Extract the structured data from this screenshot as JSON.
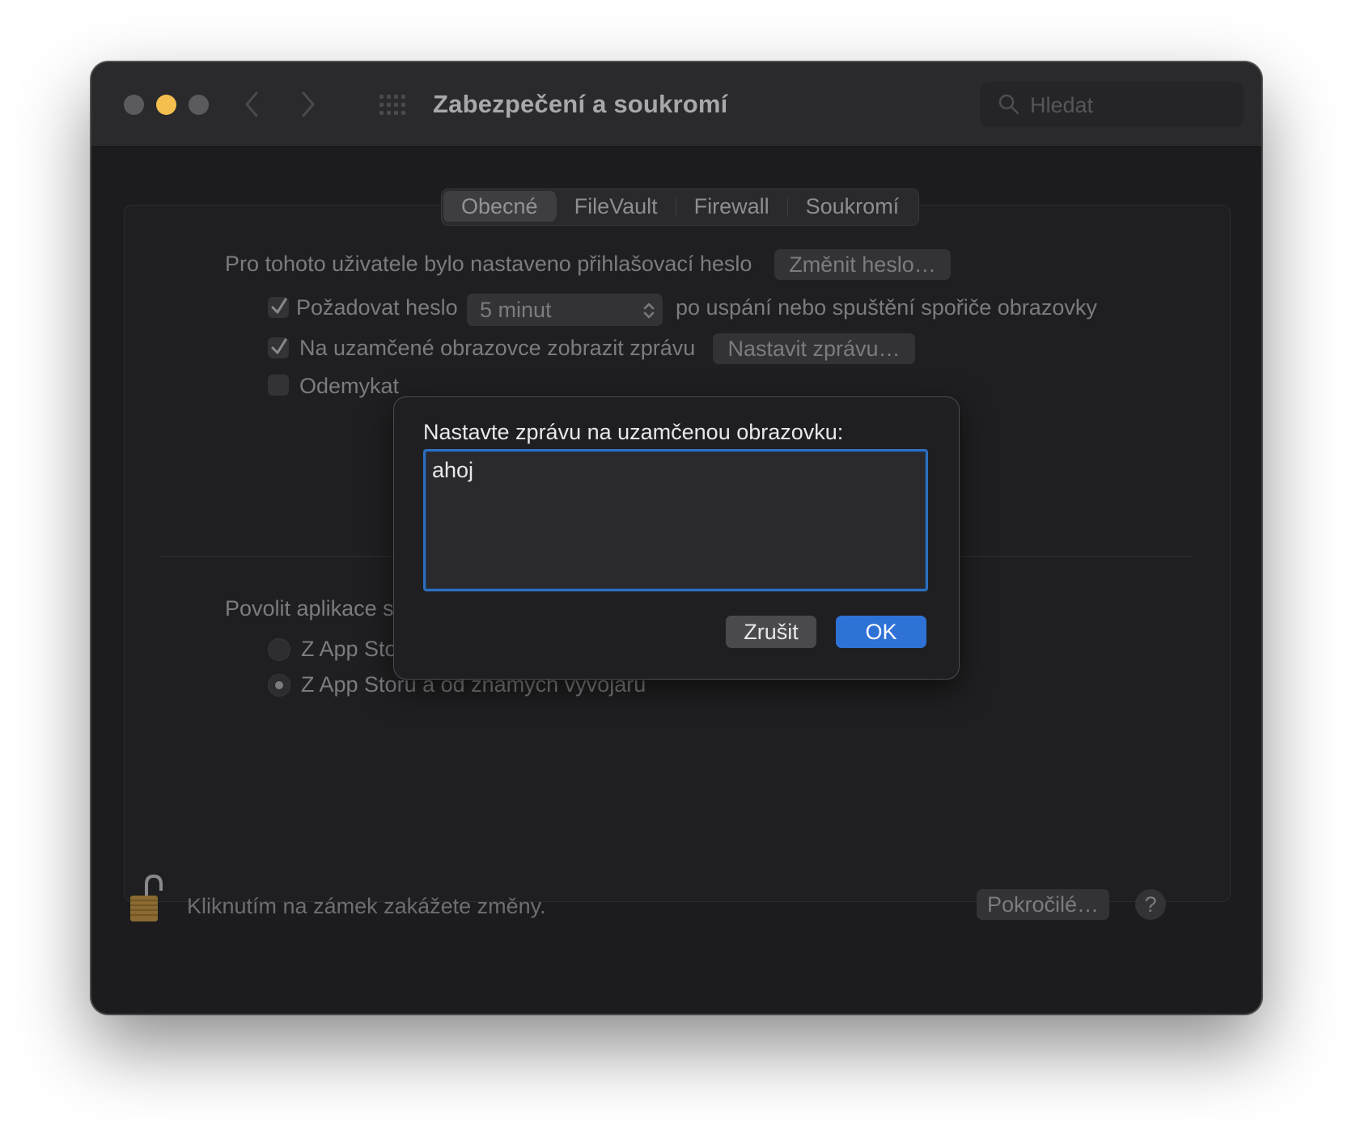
{
  "window": {
    "title": "Zabezpečení a soukromí",
    "search_placeholder": "Hledat"
  },
  "tabs": [
    {
      "label": "Obecné",
      "active": true
    },
    {
      "label": "FileVault",
      "active": false
    },
    {
      "label": "Firewall",
      "active": false
    },
    {
      "label": "Soukromí",
      "active": false
    }
  ],
  "general": {
    "password_text": "Pro tohoto uživatele bylo nastaveno přihlašovací heslo",
    "change_password_button": "Změnit heslo…",
    "require_password": {
      "label": "Požadovat heslo",
      "checked": true,
      "interval": "5 minut",
      "suffix": "po uspání nebo spuštění spořiče obrazovky"
    },
    "lock_message": {
      "label": "Na uzamčené obrazovce zobrazit zprávu",
      "checked": true,
      "button": "Nastavit zprávu…"
    },
    "unlock_partial": {
      "label": "Odemykat",
      "checked": false
    },
    "allow_apps_label": "Povolit aplikace s",
    "radio_app_store": {
      "label": "Z App Sto",
      "selected": false
    },
    "radio_app_store_devs": {
      "label": "Z App Storu a od známých vývojářů",
      "selected": true
    }
  },
  "footer": {
    "lock_text": "Kliknutím na zámek zakážete změny.",
    "advanced_button": "Pokročilé…",
    "help_button": "?"
  },
  "dialog": {
    "label": "Nastavte zprávu na uzamčenou obrazovku:",
    "message_value": "ahoj",
    "cancel_button": "Zrušit",
    "ok_button": "OK"
  },
  "colors": {
    "accent": "#2e72d6",
    "minimize": "#f5bf4f",
    "window_bg": "#1c1c1e"
  }
}
